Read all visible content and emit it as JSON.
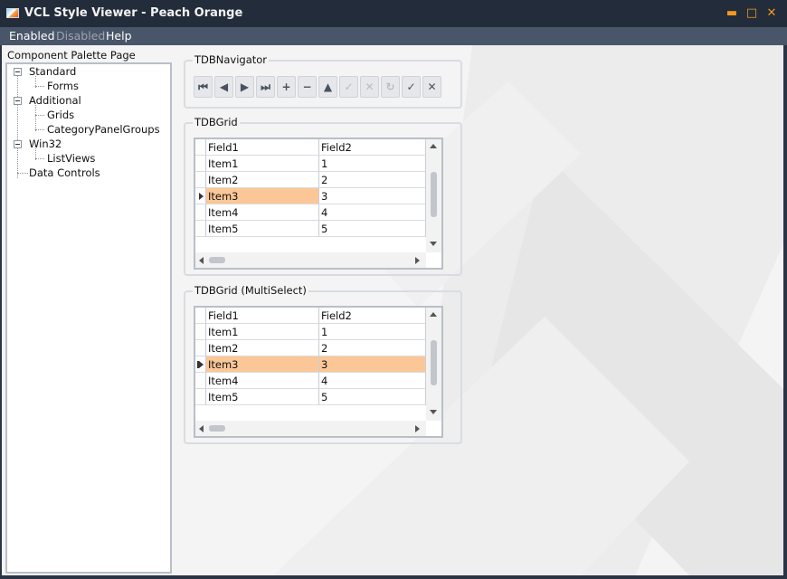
{
  "window": {
    "title": "VCL Style Viewer - Peach Orange"
  },
  "title_buttons": {
    "minimize": "▬",
    "maximize": "□",
    "close": "✕"
  },
  "menu": {
    "items": [
      {
        "label": "Enabled"
      },
      {
        "label": "Disabled"
      },
      {
        "label": "Help"
      }
    ]
  },
  "palette": {
    "label": "Component Palette Page",
    "tree": [
      {
        "label": "Standard"
      },
      {
        "label": "Forms"
      },
      {
        "label": "Additional"
      },
      {
        "label": "Grids"
      },
      {
        "label": "CategoryPanelGroups"
      },
      {
        "label": "Win32"
      },
      {
        "label": "ListViews"
      },
      {
        "label": "Data Controls"
      }
    ]
  },
  "navigator": {
    "caption": "TDBNavigator",
    "buttons": [
      {
        "icon": "first-record-icon",
        "glyph": "⏮",
        "enabled": true
      },
      {
        "icon": "prior-record-icon",
        "glyph": "◀",
        "enabled": true
      },
      {
        "icon": "next-record-icon",
        "glyph": "▶",
        "enabled": true
      },
      {
        "icon": "last-record-icon",
        "glyph": "⏭",
        "enabled": true
      },
      {
        "icon": "insert-record-icon",
        "glyph": "+",
        "enabled": true
      },
      {
        "icon": "delete-record-icon",
        "glyph": "−",
        "enabled": true
      },
      {
        "icon": "edit-record-icon",
        "glyph": "▲",
        "enabled": true
      },
      {
        "icon": "post-record-icon",
        "glyph": "✓",
        "enabled": false
      },
      {
        "icon": "cancel-record-icon",
        "glyph": "✕",
        "enabled": false
      },
      {
        "icon": "refresh-record-icon",
        "glyph": "↻",
        "enabled": false
      },
      {
        "icon": "apply-updates-icon",
        "glyph": "✓",
        "enabled": true
      },
      {
        "icon": "cancel-updates-icon",
        "glyph": "✕",
        "enabled": true
      }
    ]
  },
  "grid1": {
    "caption": "TDBGrid",
    "columns": [
      "Field1",
      "Field2"
    ],
    "rows": [
      {
        "field1": "Item1",
        "field2": "1"
      },
      {
        "field1": "Item2",
        "field2": "2"
      },
      {
        "field1": "Item3",
        "field2": "3"
      },
      {
        "field1": "Item4",
        "field2": "4"
      },
      {
        "field1": "Item5",
        "field2": "5"
      }
    ]
  },
  "grid2": {
    "caption": "TDBGrid (MultiSelect)",
    "columns": [
      "Field1",
      "Field2"
    ],
    "rows": [
      {
        "field1": "Item1",
        "field2": "1"
      },
      {
        "field1": "Item2",
        "field2": "2"
      },
      {
        "field1": "Item3",
        "field2": "3"
      },
      {
        "field1": "Item4",
        "field2": "4"
      },
      {
        "field1": "Item5",
        "field2": "5"
      }
    ]
  },
  "colors": {
    "accent": "#f39a1e",
    "selection": "#fbc797",
    "titlebar": "#232c3a",
    "menubar": "#495669"
  }
}
